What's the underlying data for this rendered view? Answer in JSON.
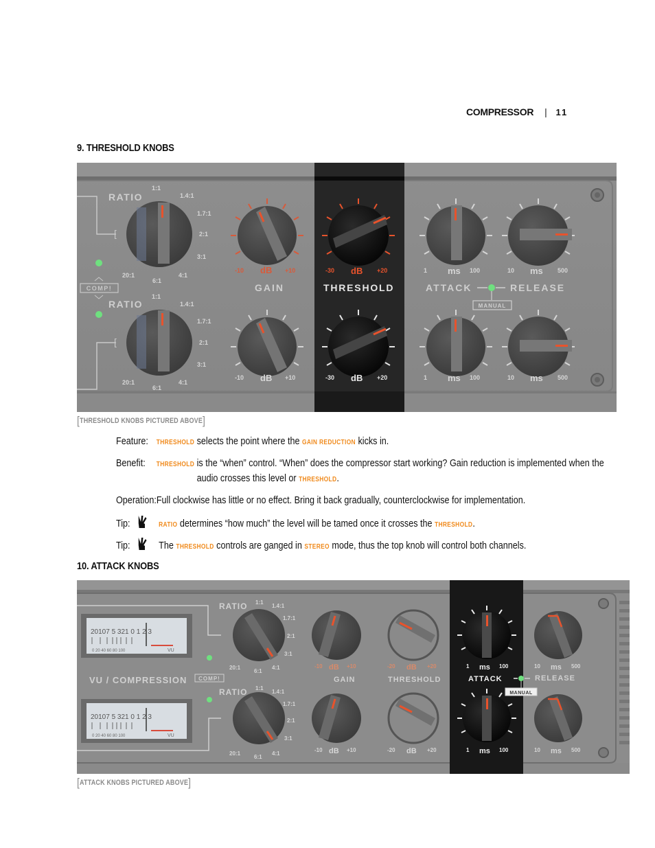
{
  "header": {
    "section": "COMPRESSOR",
    "page_number": "11"
  },
  "threshold_section": {
    "title": "9. THRESHOLD KNOBS",
    "caption": "THRESHOLD KNOBS PICTURED ABOVE",
    "panel": {
      "ratio_label": "RATIO",
      "ratio_ticks": [
        "1:1",
        "1.4:1",
        "1.7:1",
        "2:1",
        "3:1",
        "4:1",
        "6:1",
        "20:1"
      ],
      "comp_label": "COMP!",
      "gain_label": "GAIN",
      "gain_unit": "dB",
      "gain_min": "-10",
      "gain_max": "+10",
      "threshold_label": "THRESHOLD",
      "threshold_unit": "dB",
      "threshold_min": "-30",
      "threshold_max": "+20",
      "attack_label": "ATTACK",
      "attack_unit": "ms",
      "attack_min": "1",
      "attack_max": "100",
      "release_label": "RELEASE",
      "release_unit": "ms",
      "release_min": "10",
      "release_max": "500",
      "manual_label": "MANUAL"
    },
    "rows": [
      {
        "label": "Feature:",
        "parts": [
          {
            "t": "THRESHOLD",
            "hl": true
          },
          {
            "t": " selects the point where the "
          },
          {
            "t": "GAIN REDUCTION",
            "hl": true
          },
          {
            "t": " kicks in."
          }
        ]
      },
      {
        "label": "Benefit:",
        "parts": [
          {
            "t": "THRESHOLD",
            "hl": true
          },
          {
            "t": " is the “when” control. “When” does the compressor start working? Gain reduction is implemented when the"
          }
        ]
      },
      {
        "label": "",
        "parts": [
          {
            "t": "audio crosses this level or "
          },
          {
            "t": "THRESHOLD",
            "hl": true
          },
          {
            "t": "."
          }
        ]
      },
      {
        "label": "Operation:",
        "parts": [
          {
            "t": "Full clockwise has little or no effect. Bring it back gradually, counterclockwise for implementation."
          }
        ]
      },
      {
        "label": "Tip:",
        "icon": "peace-hand-icon",
        "parts": [
          {
            "t": "RATIO",
            "hl": true
          },
          {
            "t": " determines “how much” the level will be tamed once it crosses the "
          },
          {
            "t": "THRESHOLD",
            "hl": true
          },
          {
            "t": "."
          }
        ]
      },
      {
        "label": "Tip:",
        "icon": "peace-hand-icon",
        "parts": [
          {
            "t": "The "
          },
          {
            "t": "THRESHOLD",
            "hl": true
          },
          {
            "t": " controls are ganged in "
          },
          {
            "t": "STEREO",
            "hl": true
          },
          {
            "t": " mode, thus the top knob will control both channels."
          }
        ]
      }
    ]
  },
  "attack_section": {
    "title": "10. ATTACK KNOBS",
    "caption": "ATTACK KNOBS PICTURED ABOVE",
    "panel": {
      "vu_label": "VU / COMPRESSION",
      "vu_scale_top": "20 10 7 5 3 2 1 0   1   2   3",
      "vu_scale_bottom": "0 20 40 60 80 100",
      "vu_unit": "VU",
      "ratio_label": "RATIO",
      "comp_label": "COMP!",
      "gain_label": "GAIN",
      "gain_min": "-10",
      "gain_max": "+10",
      "threshold_label": "THRESHOLD",
      "threshold_min": "-20",
      "threshold_max": "+20",
      "attack_label": "ATTACK",
      "attack_min": "1",
      "attack_max": "100",
      "release_label": "RELEASE",
      "release_min": "10",
      "release_max": "500",
      "unit_db": "dB",
      "unit_ms": "ms",
      "manual_label": "MANUAL"
    }
  },
  "colors": {
    "highlight": "#f08a1c",
    "indicator_red": "#e8532c",
    "led_green": "#5fe07a"
  }
}
